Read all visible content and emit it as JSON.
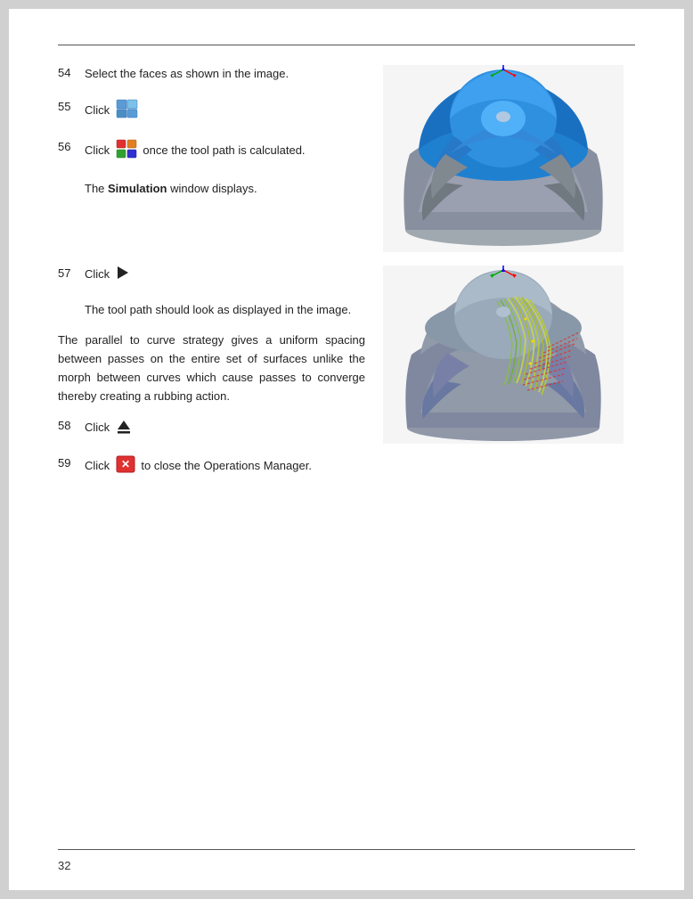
{
  "page": {
    "number": "32",
    "steps": [
      {
        "id": "54",
        "text_before_icon": "Select the faces as shown in the image.",
        "icon": null,
        "text_after_icon": ""
      },
      {
        "id": "55",
        "text_before_icon": "Click",
        "icon": "grid-icon",
        "text_after_icon": ""
      },
      {
        "id": "56",
        "text_before_icon": "Click",
        "icon": "boxes-icon",
        "text_after_icon": "once the tool path is calculated."
      },
      {
        "id": "57",
        "text_before_icon": "Click",
        "icon": "play-icon",
        "text_after_icon": ""
      },
      {
        "id": "58",
        "text_before_icon": "Click",
        "icon": "eject-icon",
        "text_after_icon": ""
      },
      {
        "id": "59",
        "text_before_icon": "Click",
        "icon": "close-icon",
        "text_after_icon": "to close the Operations Manager."
      }
    ],
    "paragraphs": {
      "simulation_window": "The ",
      "simulation_bold": "Simulation",
      "simulation_rest": " window displays.",
      "tool_path": "The tool path should look as displayed in the image.",
      "parallel_curve": "The parallel to curve strategy gives a uniform spacing between passes on the entire set of surfaces unlike the morph between curves which cause passes to converge thereby creating a rubbing action."
    }
  }
}
